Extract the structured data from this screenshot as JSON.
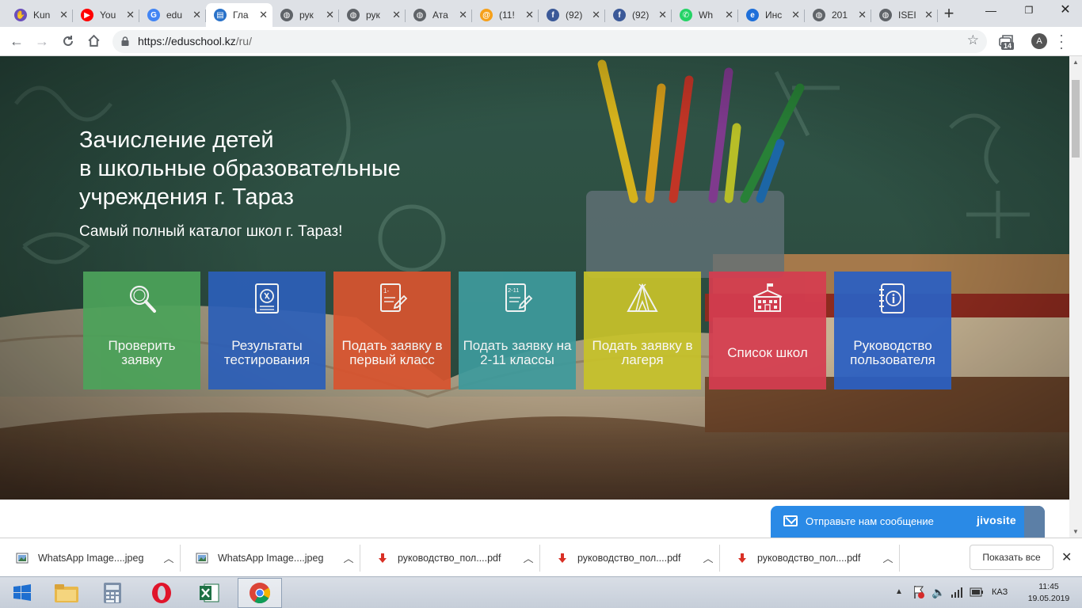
{
  "browser": {
    "tabs": [
      {
        "title": "Kun",
        "icon": "hand-favicon",
        "color": "#6b4fbb"
      },
      {
        "title": "You",
        "icon": "youtube-favicon",
        "color": "#ff0000"
      },
      {
        "title": "edu",
        "icon": "google-favicon",
        "color": "#4285f4"
      },
      {
        "title": "Гла",
        "icon": "eduschool-favicon",
        "color": "#2a72c9",
        "active": true
      },
      {
        "title": "рук",
        "icon": "globe-favicon",
        "color": "#5f6368"
      },
      {
        "title": "рук",
        "icon": "globe-favicon",
        "color": "#5f6368"
      },
      {
        "title": "Ата",
        "icon": "globe-favicon",
        "color": "#5f6368"
      },
      {
        "title": "(11!",
        "icon": "mailru-favicon",
        "color": "#f6a01a"
      },
      {
        "title": "(92)",
        "icon": "facebook-favicon",
        "color": "#3b5998"
      },
      {
        "title": "(92)",
        "icon": "facebook-favicon",
        "color": "#3b5998"
      },
      {
        "title": "Wh",
        "icon": "whatsapp-favicon",
        "color": "#25d366"
      },
      {
        "title": "Инс",
        "icon": "ie-favicon",
        "color": "#1e6fd9"
      },
      {
        "title": "201",
        "icon": "globe-favicon",
        "color": "#5f6368"
      },
      {
        "title": "ISEI",
        "icon": "globe-favicon",
        "color": "#5f6368"
      }
    ],
    "url_host": "https://eduschool.kz",
    "url_path": "/ru/",
    "extension_badge": "14",
    "avatar_letter": "A"
  },
  "hero": {
    "title_line1": "Зачисление детей",
    "title_line2": "в школьные образовательные",
    "title_line3": "учреждения г. Тараз",
    "subtitle": "Самый полный каталог школ г. Тараз!"
  },
  "tiles": [
    {
      "label": "Проверить заявку",
      "icon": "magnifier-icon",
      "color": "#4ca35a"
    },
    {
      "label": "Результаты тестирования",
      "icon": "test-results-icon",
      "color": "#2c5fb8"
    },
    {
      "label": "Подать заявку в первый класс",
      "icon": "first-grade-form-icon",
      "color": "#d8542f"
    },
    {
      "label": "Подать заявку на 2-11 классы",
      "icon": "grades-2-11-form-icon",
      "color": "#3e9a9c"
    },
    {
      "label": "Подать заявку в лагеря",
      "icon": "tent-icon",
      "color": "#c7c22a"
    },
    {
      "label": "Список школ",
      "icon": "school-building-icon",
      "color": "#d53d50"
    },
    {
      "label": "Руководство пользователя",
      "icon": "info-notebook-icon",
      "color": "#2b60c3"
    }
  ],
  "chat": {
    "text": "Отправьте нам сообщение",
    "brand": "jivosite"
  },
  "downloads": {
    "items": [
      {
        "name": "WhatsApp Image....jpeg",
        "type": "image"
      },
      {
        "name": "WhatsApp Image....jpeg",
        "type": "image"
      },
      {
        "name": "руководство_пол....pdf",
        "type": "pdf"
      },
      {
        "name": "руководство_пол....pdf",
        "type": "pdf"
      },
      {
        "name": "руководство_пол....pdf",
        "type": "pdf"
      }
    ],
    "show_all": "Показать все"
  },
  "taskbar": {
    "language": "КАЗ",
    "time": "11:45",
    "date": "19.05.2019"
  }
}
